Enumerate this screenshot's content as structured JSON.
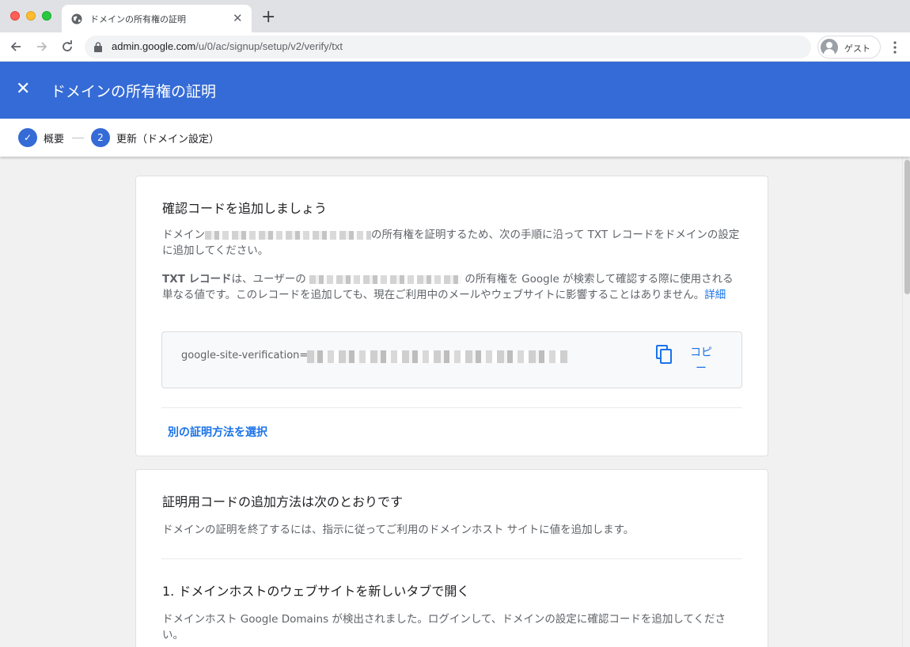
{
  "browser": {
    "tab_title": "ドメインの所有権の証明",
    "tab_close": "✕",
    "new_tab": "+",
    "url_host": "admin.google.com",
    "url_path": "/u/0/ac/signup/setup/v2/verify/txt",
    "profile_label": "ゲスト",
    "icons": {
      "back": "arrow-left-icon",
      "forward": "arrow-right-icon",
      "reload": "reload-icon",
      "lock": "lock-icon",
      "menu": "more-vert-icon"
    }
  },
  "appbar": {
    "close": "✕",
    "title": "ドメインの所有権の証明",
    "color": "#356bd6"
  },
  "stepper": {
    "step1_check": "✓",
    "step1_label": "概要",
    "step2_number": "2",
    "step2_label": "更新（ドメイン設定）"
  },
  "card1": {
    "title": "確認コードを追加しましょう",
    "p1_before": "ドメイン",
    "p1_after": "の所有権を証明するため、次の手順に沿って TXT レコードをドメインの設定に追加してください。",
    "p2_bold": "TXT レコード",
    "p2_mid": "は、ユーザーの",
    "p2_after": "の所有権を Google が検索して確認する際に使用される単なる値です。このレコードを追加しても、現在ご利用中のメールやウェブサイトに影響することはありません。",
    "p2_link": "詳細",
    "record_prefix": "google-site-verification=",
    "copy_label": "コピー",
    "alt_method_link": "別の証明方法を選択"
  },
  "card2": {
    "title": "証明用コードの追加方法は次のとおりです",
    "intro": "ドメインの証明を終了するには、指示に従ってご利用のドメインホスト サイトに値を追加します。",
    "step1_title": "1. ドメインホストのウェブサイトを新しいタブで開く",
    "step1_text": "ドメインホスト Google Domains が検出されました。ログインして、ドメインの設定に確認コードを追加してください。"
  }
}
